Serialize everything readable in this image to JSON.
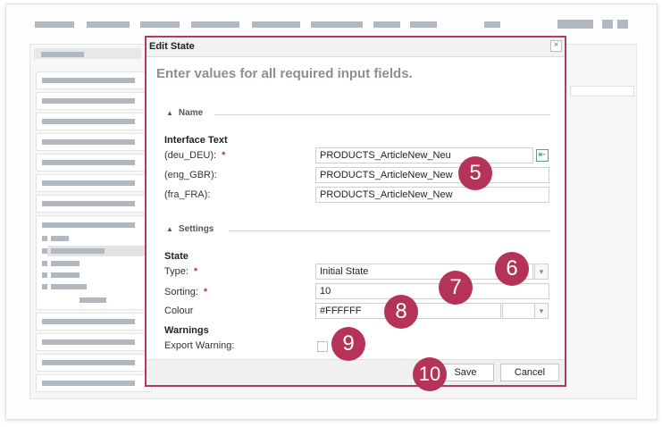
{
  "dialog": {
    "title": "Edit State",
    "close_icon": "close-icon",
    "instruction": "Enter values for all required input fields.",
    "sections": {
      "name": "Name",
      "settings": "Settings"
    },
    "interface_text": {
      "group_label": "Interface Text",
      "rows": [
        {
          "label": "(deu_DEU):",
          "required": "*",
          "value": "PRODUCTS_ArticleNew_Neu"
        },
        {
          "label": "(eng_GBR):",
          "value": "PRODUCTS_ArticleNew_New"
        },
        {
          "label": "(fra_FRA):",
          "value": "PRODUCTS_ArticleNew_New"
        }
      ],
      "translate_icon": "translate-icon"
    },
    "state": {
      "group_label": "State",
      "type_label": "Type:",
      "type_required": "*",
      "type_value": "Initial State",
      "sorting_label": "Sorting:",
      "sorting_required": "*",
      "sorting_value": "10",
      "colour_label": "Colour",
      "colour_value": "#FFFFFF"
    },
    "warnings": {
      "group_label": "Warnings",
      "export_label": "Export Warning:",
      "export_checked": false
    },
    "buttons": {
      "save": "Save",
      "cancel": "Cancel"
    }
  },
  "markers": [
    "5",
    "6",
    "7",
    "8",
    "9",
    "10"
  ],
  "colors": {
    "accent": "#b5335a",
    "dialog_border": "#b23a5a",
    "required": "#b23a3a"
  }
}
